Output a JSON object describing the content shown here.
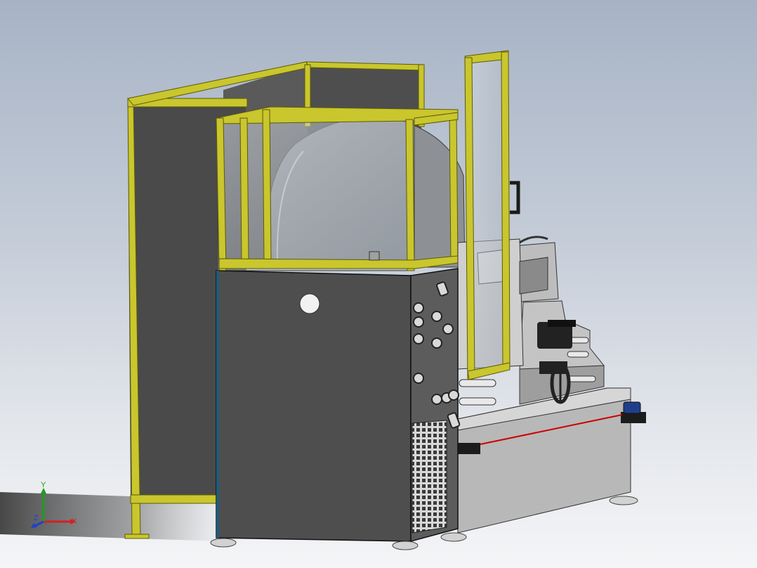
{
  "viewport": {
    "background_top": "#a7b3c5",
    "background_bottom": "#f4f5f7"
  },
  "colors": {
    "guard_frame": "#c9c62e",
    "guard_frame_dark": "#6f6b0a",
    "cabinet": "#4e4e4e",
    "cabinet_side": "#5a5a5a",
    "machine_light": "#c2c2c2",
    "machine_mid": "#a3a3a3",
    "light_curtain_beam": "#cc0000",
    "sensor": "#1f3f8a"
  },
  "triad": {
    "x_label": "X",
    "y_label": "Y",
    "z_label": "Z",
    "x_color": "#d42020",
    "y_color": "#1aa01a",
    "z_color": "#2040d0"
  }
}
